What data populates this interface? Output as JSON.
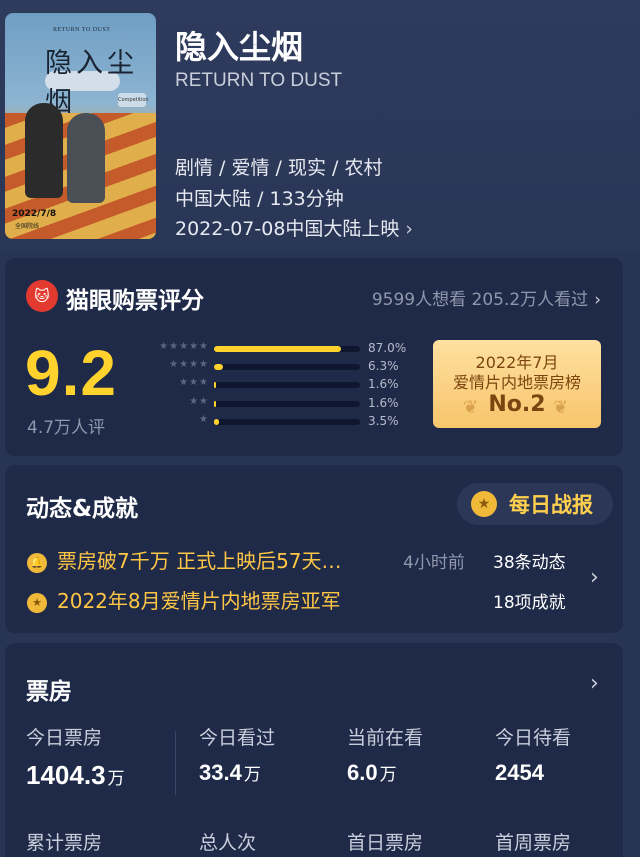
{
  "movie": {
    "title_cn": "隐入尘烟",
    "title_en": "RETURN TO DUST",
    "genres": "剧情 / 爱情 / 现实 / 农村",
    "region_duration": "中国大陆 / 133分钟",
    "release": "2022-07-08中国大陆上映",
    "poster": {
      "en_text": "RETURN TO DUST",
      "cn_text": "隐入尘烟",
      "date": "2022/7/8",
      "date_sub": "全国院线",
      "badge": "Competition"
    }
  },
  "score": {
    "title": "猫眼购票评分",
    "stats": "9599人想看 205.2万人看过",
    "value": "9.2",
    "count": "4.7万人评",
    "distribution": [
      {
        "stars": "★★★★★",
        "pct_label": "87.0%",
        "pct": 87.0
      },
      {
        "stars": "★★★★",
        "pct_label": "6.3%",
        "pct": 6.3
      },
      {
        "stars": "★★★",
        "pct_label": "1.6%",
        "pct": 1.6
      },
      {
        "stars": "★★",
        "pct_label": "1.6%",
        "pct": 1.6
      },
      {
        "stars": "★",
        "pct_label": "3.5%",
        "pct": 3.5
      }
    ],
    "rank": {
      "line1": "2022年7月",
      "line2": "爱情片内地票房榜",
      "line3": "No.2"
    }
  },
  "dynamics": {
    "title": "动态&成就",
    "daily_button": "每日战报",
    "items": [
      {
        "text": "票房破7千万 正式上映后57天…",
        "time": "4小时前",
        "count": "38条动态"
      },
      {
        "text": "2022年8月爱情片内地票房亚军",
        "time": "",
        "count": "18项成就"
      }
    ]
  },
  "boxoffice": {
    "title": "票房",
    "stats": [
      {
        "label": "今日票房",
        "value": "1404.3",
        "unit": "万"
      },
      {
        "label": "今日看过",
        "value": "33.4",
        "unit": "万"
      },
      {
        "label": "当前在看",
        "value": "6.0",
        "unit": "万"
      },
      {
        "label": "今日待看",
        "value": "2454",
        "unit": ""
      }
    ],
    "stats2": [
      {
        "label": "累计票房"
      },
      {
        "label": "总人次"
      },
      {
        "label": "首日票房"
      },
      {
        "label": "首周票房"
      }
    ]
  },
  "icons": {
    "chevron": "chevron-right-icon",
    "logo": "maoyan-cat-logo",
    "medal": "medal-icon",
    "bell": "bell-icon"
  },
  "colors": {
    "background": "#283453",
    "card": "#1f2a48",
    "accent_yellow": "#ffd22e",
    "rank_gold": "#f7c56b"
  }
}
